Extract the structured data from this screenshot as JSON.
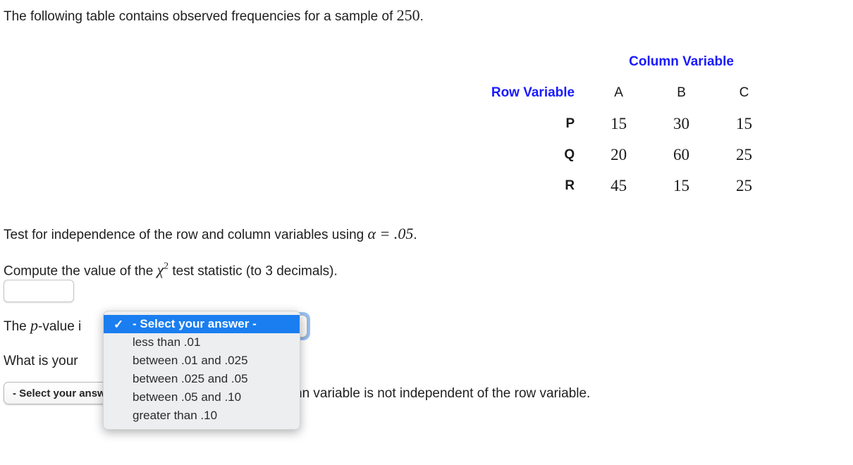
{
  "prompt": {
    "intro_prefix": "The following table contains observed frequencies for a sample of ",
    "intro_sample_size": "250",
    "intro_suffix": ".",
    "test_line_prefix": "Test for independence of the row and column variables using ",
    "test_line_alpha": "α = .05",
    "test_line_suffix": ".",
    "compute_prefix": "Compute the value of the ",
    "compute_chi": "χ",
    "compute_chi_exp": "2",
    "compute_suffix": " test statistic (to 3 decimals).",
    "pvalue_prefix": "The ",
    "pvalue_p": "p",
    "pvalue_suffix": "-value i",
    "conclusion_prefix": "What is your",
    "conclusion_suffix": "nn variable is not independent of the row variable."
  },
  "table": {
    "column_variable_title": "Column Variable",
    "row_variable_title": "Row Variable",
    "column_headers": [
      "A",
      "B",
      "C"
    ],
    "rows": [
      {
        "label": "P",
        "values": [
          "15",
          "30",
          "15"
        ]
      },
      {
        "label": "Q",
        "values": [
          "20",
          "60",
          "25"
        ]
      },
      {
        "label": "R",
        "values": [
          "45",
          "15",
          "25"
        ]
      }
    ]
  },
  "chi_input": {
    "value": "",
    "placeholder": ""
  },
  "pvalue_select": {
    "display_value": "- Select your answer -",
    "open": true,
    "selected_index": 0,
    "check_glyph": "✓",
    "options": [
      "- Select your answer -",
      "less than .01",
      "between .01 and .025",
      "between .025 and .05",
      "between .05 and .10",
      "greater than .10"
    ]
  },
  "conclusion_select": {
    "display_value": "- Select your answer -"
  },
  "colors": {
    "heading_blue": "#1a1aff",
    "menu_highlight": "#1a7ef0",
    "menu_background": "#eceef0",
    "text": "#1f1f1f"
  }
}
